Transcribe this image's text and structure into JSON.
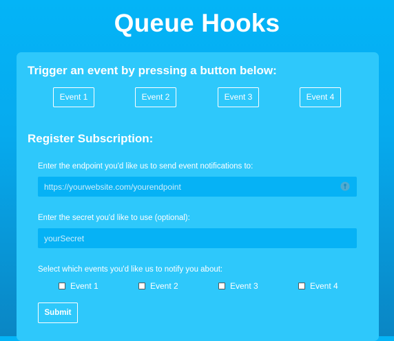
{
  "page": {
    "title": "Queue Hooks"
  },
  "trigger": {
    "heading": "Trigger an event by pressing a button below:",
    "buttons": [
      "Event 1",
      "Event 2",
      "Event 3",
      "Event 4"
    ]
  },
  "register": {
    "heading": "Register Subscription:",
    "endpoint": {
      "label": "Enter the endpoint you'd like us to send event notifications to:",
      "placeholder": "https://yourwebsite.com/yourendpoint",
      "value": ""
    },
    "secret": {
      "label": "Enter the secret you'd like to use (optional):",
      "placeholder": "yourSecret",
      "value": ""
    },
    "events": {
      "label": "Select which events you'd like us to notify you about:",
      "options": [
        {
          "label": "Event 1",
          "checked": false
        },
        {
          "label": "Event 2",
          "checked": false
        },
        {
          "label": "Event 3",
          "checked": false
        },
        {
          "label": "Event 4",
          "checked": false
        }
      ]
    },
    "submit_label": "Submit"
  },
  "icons": {
    "endpoint_field_icon": "autofill-key-icon"
  },
  "colors": {
    "background": "#04b4f7",
    "card": "#2ec8fb",
    "input": "#06b2f5",
    "text": "#ffffff"
  }
}
